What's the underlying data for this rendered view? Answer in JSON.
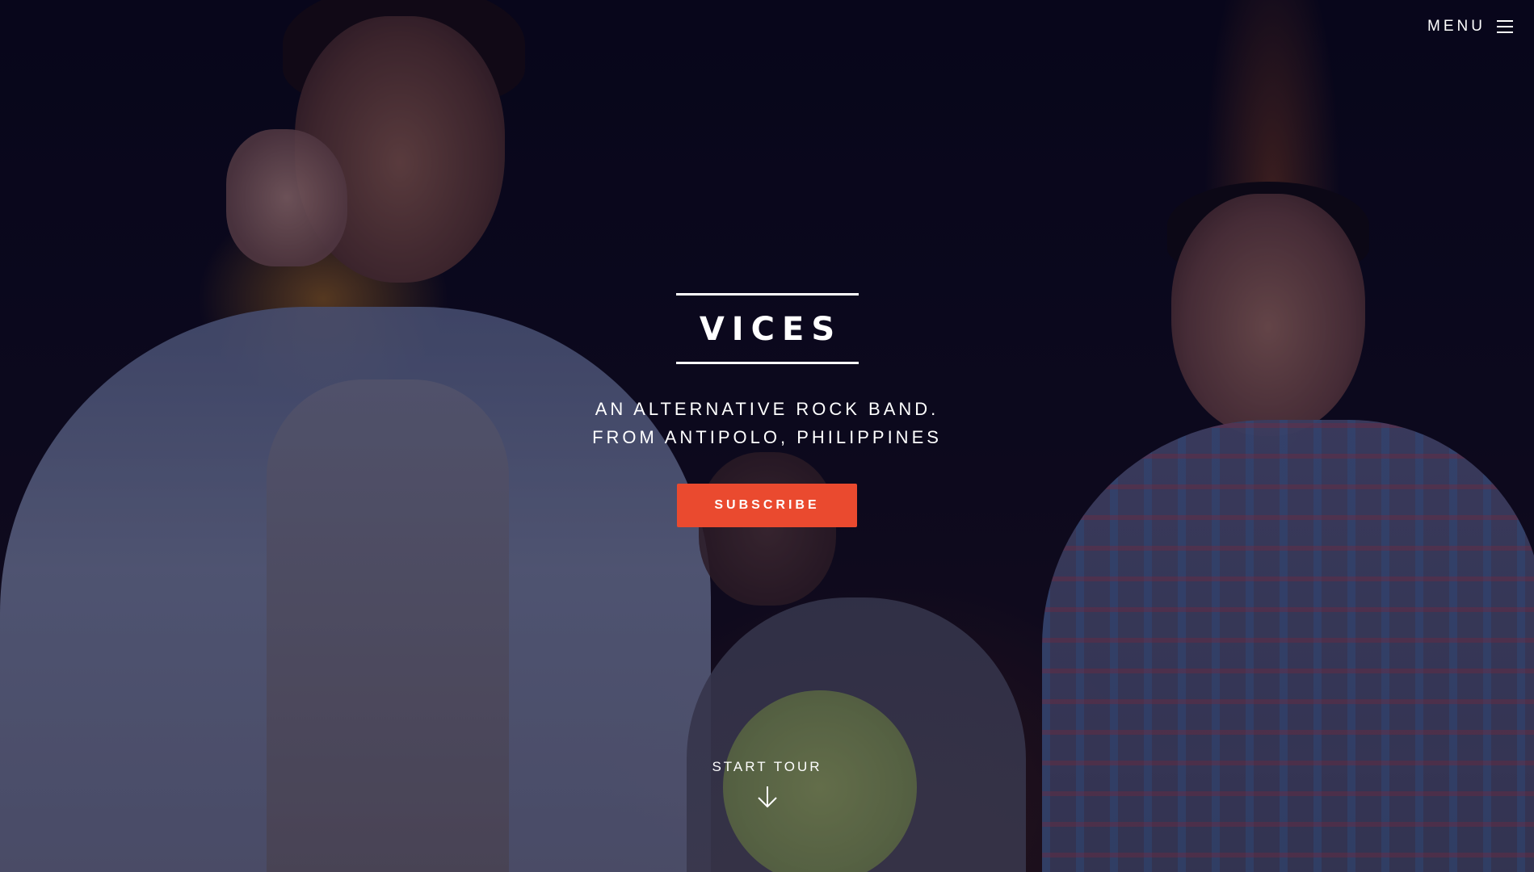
{
  "header": {
    "menu_label": "MENU",
    "menu_icon": "hamburger-icon"
  },
  "hero": {
    "logo": "VICES",
    "tagline_line1": "AN ALTERNATIVE ROCK BAND.",
    "tagline_line2": "FROM ANTIPOLO, PHILIPPINES",
    "cta_label": "SUBSCRIBE",
    "tour_label": "START TOUR",
    "tour_icon": "arrow-down-icon"
  },
  "colors": {
    "accent": "#ea4a2f",
    "text": "#ffffff"
  }
}
